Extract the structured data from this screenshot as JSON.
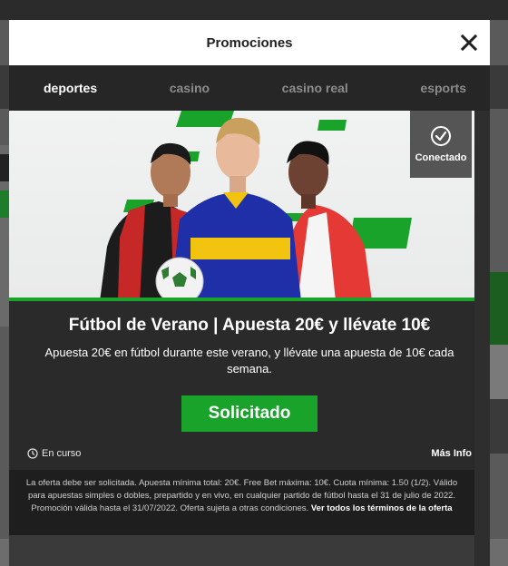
{
  "modal": {
    "title": "Promociones",
    "tabs": [
      {
        "label": "deportes",
        "active": true
      },
      {
        "label": "casino",
        "active": false
      },
      {
        "label": "casino real",
        "active": false
      },
      {
        "label": "esports",
        "active": false
      }
    ],
    "badge": {
      "label": "Conectado",
      "icon": "check-circle-icon"
    },
    "promo": {
      "title": "Fútbol de Verano | Apuesta 20€ y llévate 10€",
      "description": "Apuesta 20€ en fútbol durante este verano, y llévate una apuesta de 10€ cada semana.",
      "cta_label": "Solicitado",
      "status_label": "En curso",
      "more_info_label": "Más Info"
    },
    "terms": {
      "text": "La oferta debe ser solicitada. Apuesta mínima total: 20€. Free Bet máxima: 10€. Cuota mínima: 1.50 (1/2). Válido para apuestas simples o dobles, prepartido y en vivo, en cualquier partido de fútbol hasta el 31 de julio de 2022. Promoción válida hasta el 31/07/2022. Oferta sujeta a otras condiciones.",
      "link_label": "Ver todos los términos de la oferta"
    }
  },
  "colors": {
    "accent_green": "#1aa32a",
    "modal_bg": "#2a2a2a",
    "header_bg": "#ffffff"
  }
}
